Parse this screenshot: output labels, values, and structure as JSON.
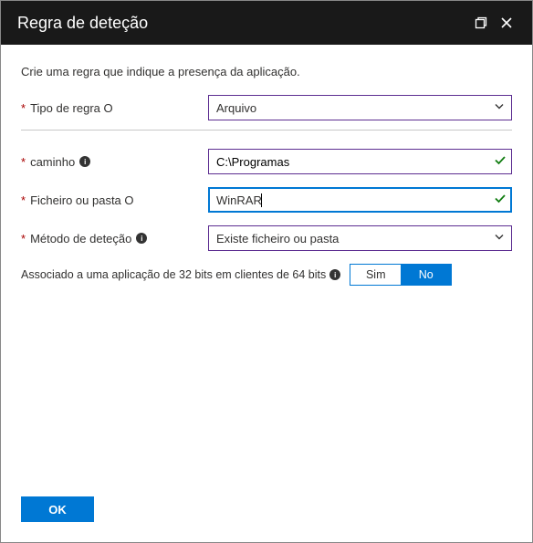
{
  "header": {
    "title": "Regra de deteção"
  },
  "intro": "Crie uma regra que indique a presença da aplicação.",
  "fields": {
    "ruleType": {
      "label": "Tipo de regra O",
      "value": "Arquivo"
    },
    "path": {
      "label": "caminho",
      "value": "C:\\Programas"
    },
    "file": {
      "label": "Ficheiro ou pasta O",
      "value": "WinRAR"
    },
    "method": {
      "label": "Método de deteção",
      "value": "Existe ficheiro ou pasta"
    }
  },
  "assoc": {
    "label": "Associado a uma aplicação de 32 bits em clientes de 64 bits",
    "yes": "Sim",
    "no": "No",
    "selected": "no"
  },
  "footer": {
    "ok": "OK"
  }
}
